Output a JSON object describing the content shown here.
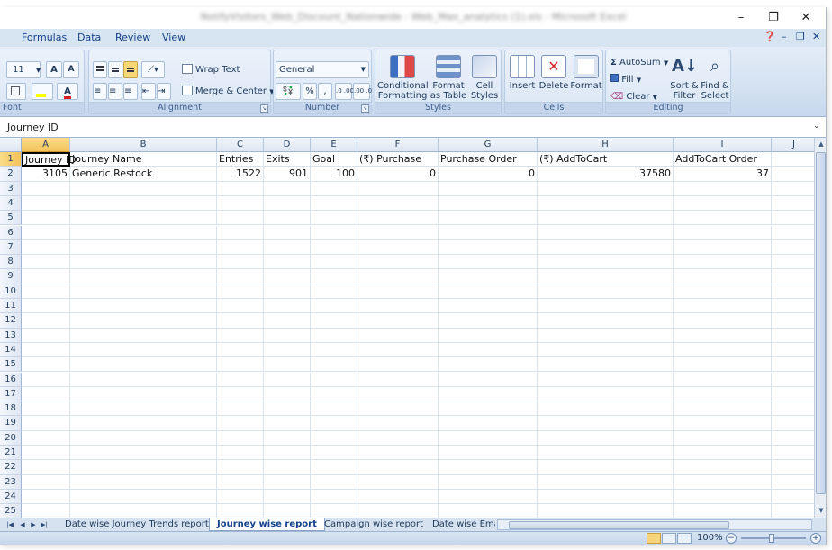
{
  "window": {
    "title": "NotifyVisitors_Web_Discount_Nationwide - Web_Max_analytics (1).xls - Microsoft Excel",
    "controls": [
      "–",
      "❐",
      "✕"
    ]
  },
  "ribbon_tabs": [
    "Formulas",
    "Data",
    "Review",
    "View"
  ],
  "ribbon_right": [
    "❓",
    "–",
    "❐",
    "✕"
  ],
  "ribbon": {
    "font": {
      "size": "11",
      "group_label": "Font"
    },
    "alignment": {
      "wrap_text": "Wrap Text",
      "merge_center": "Merge & Center",
      "group_label": "Alignment"
    },
    "number": {
      "format": "General",
      "percent": "%",
      "comma": ",",
      "inc": ".0 .00",
      "dec": ".00 .0",
      "group_label": "Number"
    },
    "styles": {
      "conditional": [
        "Conditional",
        "Formatting"
      ],
      "format_table": [
        "Format",
        "as Table"
      ],
      "cell_styles": [
        "Cell",
        "Styles"
      ],
      "group_label": "Styles"
    },
    "cells": {
      "insert": "Insert",
      "delete": "Delete",
      "format": "Format",
      "group_label": "Cells"
    },
    "editing": {
      "autosum": "AutoSum",
      "fill": "Fill",
      "clear": "Clear",
      "sort_filter": [
        "Sort &",
        "Filter"
      ],
      "find_select": [
        "Find &",
        "Select"
      ],
      "group_label": "Editing"
    }
  },
  "formula_bar": {
    "content": "Journey ID"
  },
  "grid": {
    "columns": [
      "A",
      "B",
      "C",
      "D",
      "E",
      "F",
      "G",
      "H",
      "I",
      "J"
    ],
    "rows": [
      "1",
      "2",
      "3",
      "4",
      "5",
      "6",
      "7",
      "8",
      "9",
      "10",
      "11",
      "12",
      "13",
      "14",
      "15",
      "16",
      "17",
      "18",
      "19",
      "20",
      "21",
      "22",
      "23",
      "24",
      "25"
    ],
    "header_row": [
      "Journey ID",
      "Journey Name",
      "Entries",
      "Exits",
      "Goal",
      "(₹) Purchase",
      "Purchase Order",
      "(₹) AddToCart",
      "AddToCart Order",
      ""
    ],
    "data_rows": [
      [
        "3105",
        "Generic Restock",
        "1522",
        "901",
        "100",
        "0",
        "0",
        "37580",
        "37",
        ""
      ]
    ]
  },
  "sheets": {
    "tabs": [
      "Date wise Journey Trends report",
      "Journey wise report",
      "Campaign wise report",
      "Date wise Emai"
    ],
    "active": "Journey wise report"
  },
  "status": {
    "zoom": "100%"
  },
  "colors": {
    "accent": "#15428b",
    "ribbon_bg": "#d3e1f1",
    "selection": "#f3c25b"
  }
}
